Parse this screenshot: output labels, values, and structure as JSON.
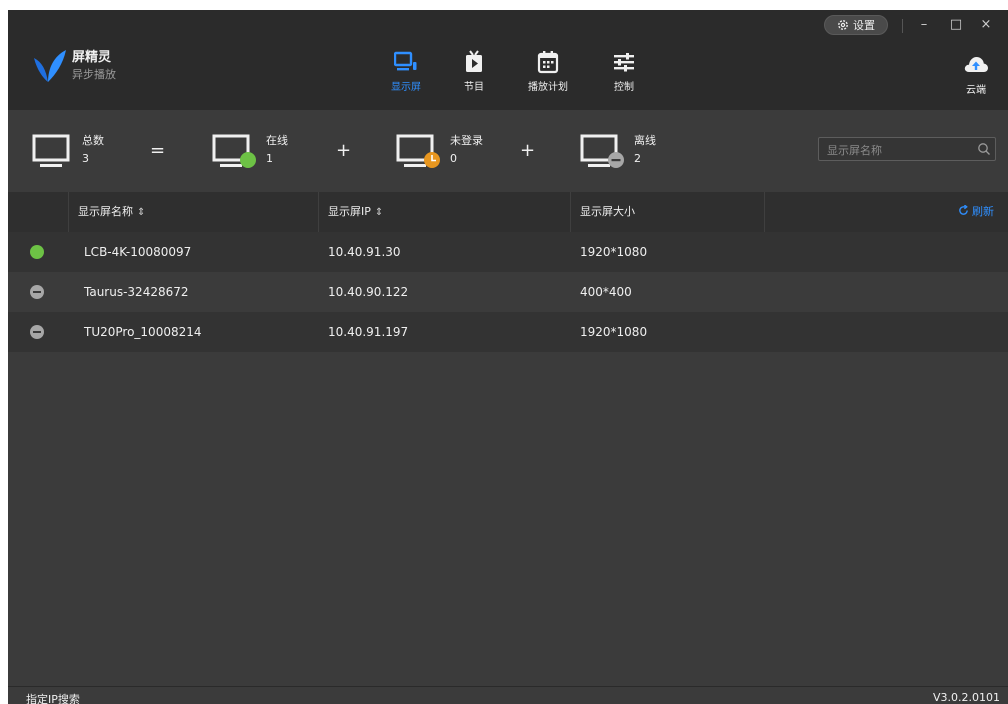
{
  "app": {
    "name": "屏精灵",
    "subtitle": "异步播放"
  },
  "nav": [
    {
      "label": "显示屏",
      "active": true
    },
    {
      "label": "节目",
      "active": false
    },
    {
      "label": "播放计划",
      "active": false
    },
    {
      "label": "控制",
      "active": false
    }
  ],
  "window": {
    "settings_label": "设置",
    "minimize": "–",
    "maximize": "□",
    "close": "×"
  },
  "cloud": {
    "label": "云端"
  },
  "stats": {
    "total": {
      "label": "总数",
      "value": "3"
    },
    "equals": "=",
    "plus": "+",
    "online": {
      "label": "在线",
      "value": "1"
    },
    "not_logged_in": {
      "label": "未登录",
      "value": "0"
    },
    "offline": {
      "label": "离线",
      "value": "2"
    }
  },
  "search": {
    "placeholder": "显示屏名称"
  },
  "table": {
    "columns": [
      "显示屏名称",
      "显示屏IP",
      "显示屏大小"
    ],
    "sort_icon": "⇕",
    "refresh_label": "刷新",
    "rows": [
      {
        "status": "online",
        "name": "LCB-4K-10080097",
        "ip": "10.40.91.30",
        "size": "1920*1080"
      },
      {
        "status": "offline",
        "name": "Taurus-32428672",
        "ip": "10.40.90.122",
        "size": "400*400"
      },
      {
        "status": "offline",
        "name": "TU20Pro_10008214",
        "ip": "10.40.91.197",
        "size": "1920*1080"
      }
    ]
  },
  "footer": {
    "ip_search": "指定IP搜索",
    "version": "V3.0.2.0101"
  },
  "colors": {
    "accent": "#2f8fff",
    "online": "#6dc245",
    "pending": "#e7961f",
    "offline": "#a7a7a7"
  }
}
